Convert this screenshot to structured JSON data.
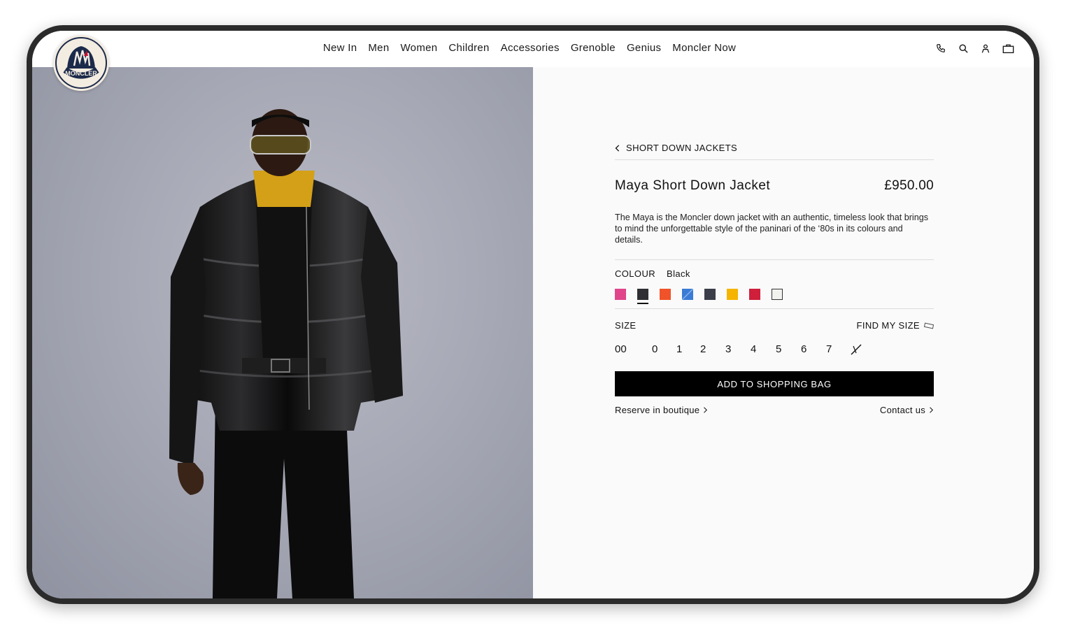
{
  "brand": {
    "logo_text": "MONCLER"
  },
  "nav": {
    "items": [
      "New In",
      "Men",
      "Women",
      "Children",
      "Accessories",
      "Grenoble",
      "Genius",
      "Moncler Now"
    ]
  },
  "header_icons": [
    "phone-icon",
    "search-icon",
    "account-icon",
    "shopping-bag-icon"
  ],
  "breadcrumb": {
    "label": "SHORT DOWN JACKETS"
  },
  "product": {
    "title": "Maya Short Down Jacket",
    "price": "£950.00",
    "description": "The Maya is the Moncler down jacket with an authentic, timeless look that brings to mind the unforgettable style of the paninari of the ‘80s in its colours and details."
  },
  "colour": {
    "label": "COLOUR",
    "selected": "Black",
    "swatches": [
      "#e0458c",
      "#2f2f33",
      "#f0532a",
      "#3a7bd5",
      "#3b3d48",
      "#f5b400",
      "#cf1f3b",
      "#f2f2ee"
    ]
  },
  "size": {
    "label": "SIZE",
    "find_my_size": "FIND MY SIZE",
    "options": [
      "00",
      "0",
      "1",
      "2",
      "3",
      "4",
      "5",
      "6",
      "7"
    ]
  },
  "add_to_bag": "ADD TO SHOPPING BAG",
  "links": {
    "reserve": "Reserve in boutique",
    "contact": "Contact us"
  }
}
